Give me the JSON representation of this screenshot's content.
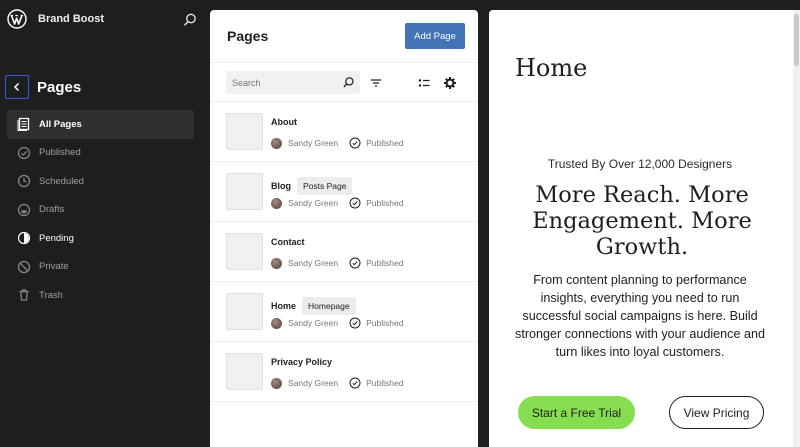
{
  "site": {
    "title": "Brand Boost"
  },
  "sidebar": {
    "heading": "Pages",
    "items": [
      {
        "label": "All Pages",
        "icon": "pages-icon"
      },
      {
        "label": "Published",
        "icon": "published-icon"
      },
      {
        "label": "Scheduled",
        "icon": "scheduled-icon"
      },
      {
        "label": "Drafts",
        "icon": "drafts-icon"
      },
      {
        "label": "Pending",
        "icon": "pending-icon"
      },
      {
        "label": "Private",
        "icon": "private-icon"
      },
      {
        "label": "Trash",
        "icon": "trash-icon"
      }
    ]
  },
  "panel": {
    "title": "Pages",
    "add_label": "Add Page",
    "search_placeholder": "Search"
  },
  "pages": [
    {
      "title": "About",
      "badge": "",
      "author": "Sandy Green",
      "status": "Published"
    },
    {
      "title": "Blog",
      "badge": "Posts Page",
      "author": "Sandy Green",
      "status": "Published"
    },
    {
      "title": "Contact",
      "badge": "",
      "author": "Sandy Green",
      "status": "Published"
    },
    {
      "title": "Home",
      "badge": "Homepage",
      "author": "Sandy Green",
      "status": "Published"
    },
    {
      "title": "Privacy Policy",
      "badge": "",
      "author": "Sandy Green",
      "status": "Published"
    }
  ],
  "preview": {
    "title": "Home",
    "trusted": "Trusted By Over 12,000 Designers",
    "headline": "More Reach. More Engagement. More Growth.",
    "body": "From content planning to performance insights, everything you need to run successful social campaigns is here. Build stronger connections with your audience and turn likes into loyal customers.",
    "cta_primary": "Start a Free Trial",
    "cta_secondary": "View Pricing"
  },
  "colors": {
    "accent": "#3858e9",
    "add_button": "#4273b5",
    "cta_green": "#86dd4f",
    "sidebar_bg": "#1e1e1e"
  }
}
